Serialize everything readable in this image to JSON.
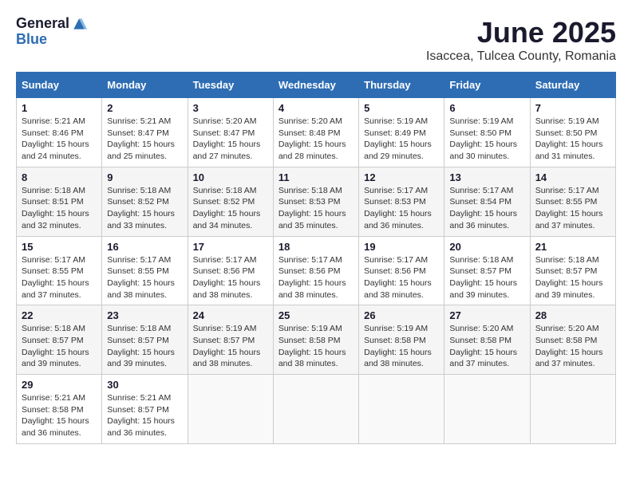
{
  "logo": {
    "general": "General",
    "blue": "Blue"
  },
  "header": {
    "month": "June 2025",
    "location": "Isaccea, Tulcea County, Romania"
  },
  "weekdays": [
    "Sunday",
    "Monday",
    "Tuesday",
    "Wednesday",
    "Thursday",
    "Friday",
    "Saturday"
  ],
  "weeks": [
    [
      {
        "day": 1,
        "sunrise": "5:21 AM",
        "sunset": "8:46 PM",
        "daylight": "15 hours and 24 minutes."
      },
      {
        "day": 2,
        "sunrise": "5:21 AM",
        "sunset": "8:47 PM",
        "daylight": "15 hours and 25 minutes."
      },
      {
        "day": 3,
        "sunrise": "5:20 AM",
        "sunset": "8:47 PM",
        "daylight": "15 hours and 27 minutes."
      },
      {
        "day": 4,
        "sunrise": "5:20 AM",
        "sunset": "8:48 PM",
        "daylight": "15 hours and 28 minutes."
      },
      {
        "day": 5,
        "sunrise": "5:19 AM",
        "sunset": "8:49 PM",
        "daylight": "15 hours and 29 minutes."
      },
      {
        "day": 6,
        "sunrise": "5:19 AM",
        "sunset": "8:50 PM",
        "daylight": "15 hours and 30 minutes."
      },
      {
        "day": 7,
        "sunrise": "5:19 AM",
        "sunset": "8:50 PM",
        "daylight": "15 hours and 31 minutes."
      }
    ],
    [
      {
        "day": 8,
        "sunrise": "5:18 AM",
        "sunset": "8:51 PM",
        "daylight": "15 hours and 32 minutes."
      },
      {
        "day": 9,
        "sunrise": "5:18 AM",
        "sunset": "8:52 PM",
        "daylight": "15 hours and 33 minutes."
      },
      {
        "day": 10,
        "sunrise": "5:18 AM",
        "sunset": "8:52 PM",
        "daylight": "15 hours and 34 minutes."
      },
      {
        "day": 11,
        "sunrise": "5:18 AM",
        "sunset": "8:53 PM",
        "daylight": "15 hours and 35 minutes."
      },
      {
        "day": 12,
        "sunrise": "5:17 AM",
        "sunset": "8:53 PM",
        "daylight": "15 hours and 36 minutes."
      },
      {
        "day": 13,
        "sunrise": "5:17 AM",
        "sunset": "8:54 PM",
        "daylight": "15 hours and 36 minutes."
      },
      {
        "day": 14,
        "sunrise": "5:17 AM",
        "sunset": "8:55 PM",
        "daylight": "15 hours and 37 minutes."
      }
    ],
    [
      {
        "day": 15,
        "sunrise": "5:17 AM",
        "sunset": "8:55 PM",
        "daylight": "15 hours and 37 minutes."
      },
      {
        "day": 16,
        "sunrise": "5:17 AM",
        "sunset": "8:55 PM",
        "daylight": "15 hours and 38 minutes."
      },
      {
        "day": 17,
        "sunrise": "5:17 AM",
        "sunset": "8:56 PM",
        "daylight": "15 hours and 38 minutes."
      },
      {
        "day": 18,
        "sunrise": "5:17 AM",
        "sunset": "8:56 PM",
        "daylight": "15 hours and 38 minutes."
      },
      {
        "day": 19,
        "sunrise": "5:17 AM",
        "sunset": "8:56 PM",
        "daylight": "15 hours and 38 minutes."
      },
      {
        "day": 20,
        "sunrise": "5:18 AM",
        "sunset": "8:57 PM",
        "daylight": "15 hours and 39 minutes."
      },
      {
        "day": 21,
        "sunrise": "5:18 AM",
        "sunset": "8:57 PM",
        "daylight": "15 hours and 39 minutes."
      }
    ],
    [
      {
        "day": 22,
        "sunrise": "5:18 AM",
        "sunset": "8:57 PM",
        "daylight": "15 hours and 39 minutes."
      },
      {
        "day": 23,
        "sunrise": "5:18 AM",
        "sunset": "8:57 PM",
        "daylight": "15 hours and 39 minutes."
      },
      {
        "day": 24,
        "sunrise": "5:19 AM",
        "sunset": "8:57 PM",
        "daylight": "15 hours and 38 minutes."
      },
      {
        "day": 25,
        "sunrise": "5:19 AM",
        "sunset": "8:58 PM",
        "daylight": "15 hours and 38 minutes."
      },
      {
        "day": 26,
        "sunrise": "5:19 AM",
        "sunset": "8:58 PM",
        "daylight": "15 hours and 38 minutes."
      },
      {
        "day": 27,
        "sunrise": "5:20 AM",
        "sunset": "8:58 PM",
        "daylight": "15 hours and 37 minutes."
      },
      {
        "day": 28,
        "sunrise": "5:20 AM",
        "sunset": "8:58 PM",
        "daylight": "15 hours and 37 minutes."
      }
    ],
    [
      {
        "day": 29,
        "sunrise": "5:21 AM",
        "sunset": "8:58 PM",
        "daylight": "15 hours and 36 minutes."
      },
      {
        "day": 30,
        "sunrise": "5:21 AM",
        "sunset": "8:57 PM",
        "daylight": "15 hours and 36 minutes."
      },
      null,
      null,
      null,
      null,
      null
    ]
  ]
}
